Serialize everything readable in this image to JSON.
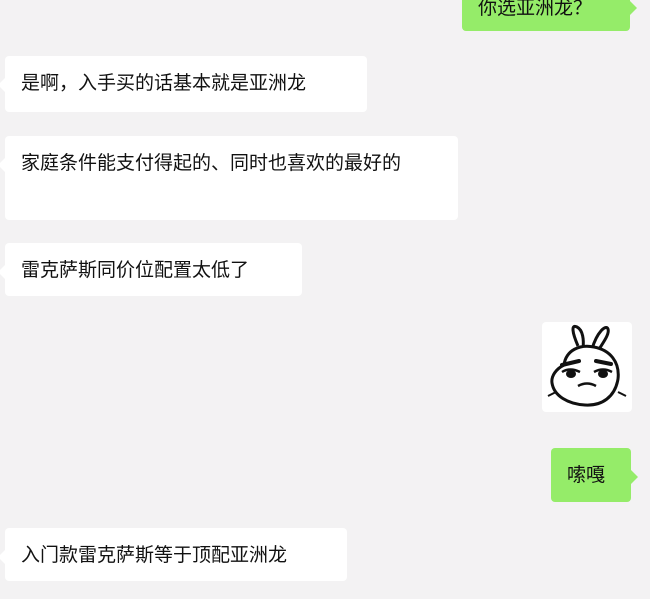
{
  "messages": [
    {
      "side": "right",
      "text": "你选亚洲龙？"
    },
    {
      "side": "left",
      "text": "是啊，入手买的话基本就是亚洲龙"
    },
    {
      "side": "left",
      "text": "家庭条件能支付得起的、同时也喜欢的最好的"
    },
    {
      "side": "left",
      "text": "雷克萨斯同价位配置太低了"
    },
    {
      "side": "right",
      "sticker": "angry-rabbit-sticker"
    },
    {
      "side": "right",
      "text": "嗦嘎"
    },
    {
      "side": "left",
      "text": "入门款雷克萨斯等于顶配亚洲龙"
    }
  ],
  "colors": {
    "background": "#f3f2f3",
    "incoming_bubble": "#ffffff",
    "outgoing_bubble": "#95ec69"
  }
}
